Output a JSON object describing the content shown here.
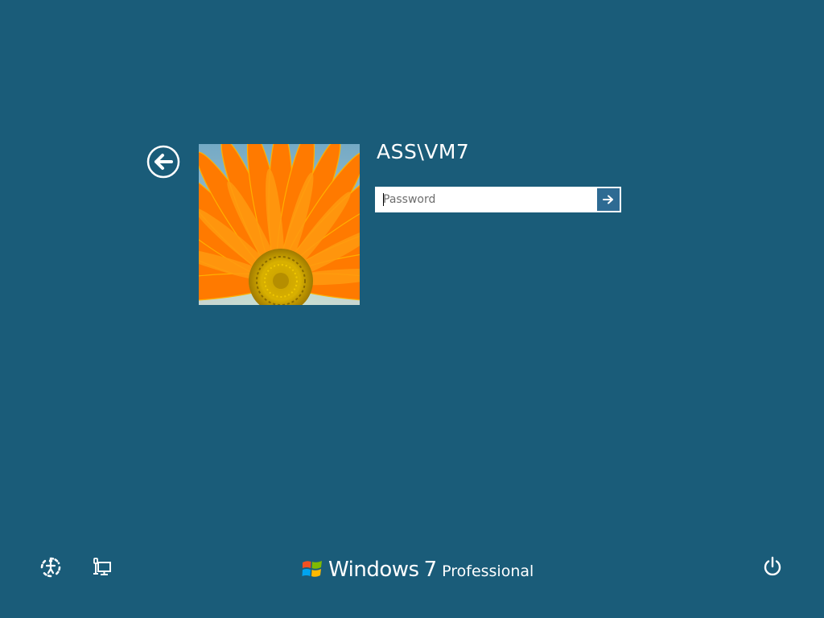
{
  "login": {
    "username": "ASS\\VM7",
    "password_placeholder": "Password",
    "password_value": ""
  },
  "icons": {
    "back": "back-arrow-icon",
    "submit": "arrow-right-icon",
    "ease_of_access": "ease-of-access-icon",
    "network": "network-icon",
    "power": "power-icon",
    "logo": "windows-flag-logo",
    "avatar": "flower-avatar"
  },
  "branding": {
    "name": "Windows",
    "version": "7",
    "edition": "Professional"
  },
  "colors": {
    "background": "#1a5c79",
    "submit_button": "#2e6b93",
    "text": "#ffffff"
  }
}
